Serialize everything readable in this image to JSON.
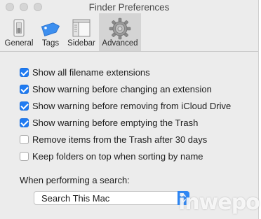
{
  "window": {
    "title": "Finder Preferences"
  },
  "toolbar": {
    "items": [
      {
        "label": "General",
        "icon": "general-switch-icon"
      },
      {
        "label": "Tags",
        "icon": "tag-icon"
      },
      {
        "label": "Sidebar",
        "icon": "sidebar-icon"
      },
      {
        "label": "Advanced",
        "icon": "gear-icon",
        "selected": true
      }
    ]
  },
  "options": [
    {
      "label": "Show all filename extensions",
      "checked": true
    },
    {
      "label": "Show warning before changing an extension",
      "checked": true
    },
    {
      "label": "Show warning before removing from iCloud Drive",
      "checked": true
    },
    {
      "label": "Show warning before emptying the Trash",
      "checked": true
    },
    {
      "label": "Remove items from the Trash after 30 days",
      "checked": false
    },
    {
      "label": "Keep folders on top when sorting by name",
      "checked": false
    }
  ],
  "search": {
    "label": "When performing a search:",
    "selected_value": "Search This Mac"
  },
  "watermark": "inwepo",
  "colors": {
    "accent": "#1f7bf2",
    "tag_blue": "#3d8fef",
    "window_bg": "#ececec"
  }
}
